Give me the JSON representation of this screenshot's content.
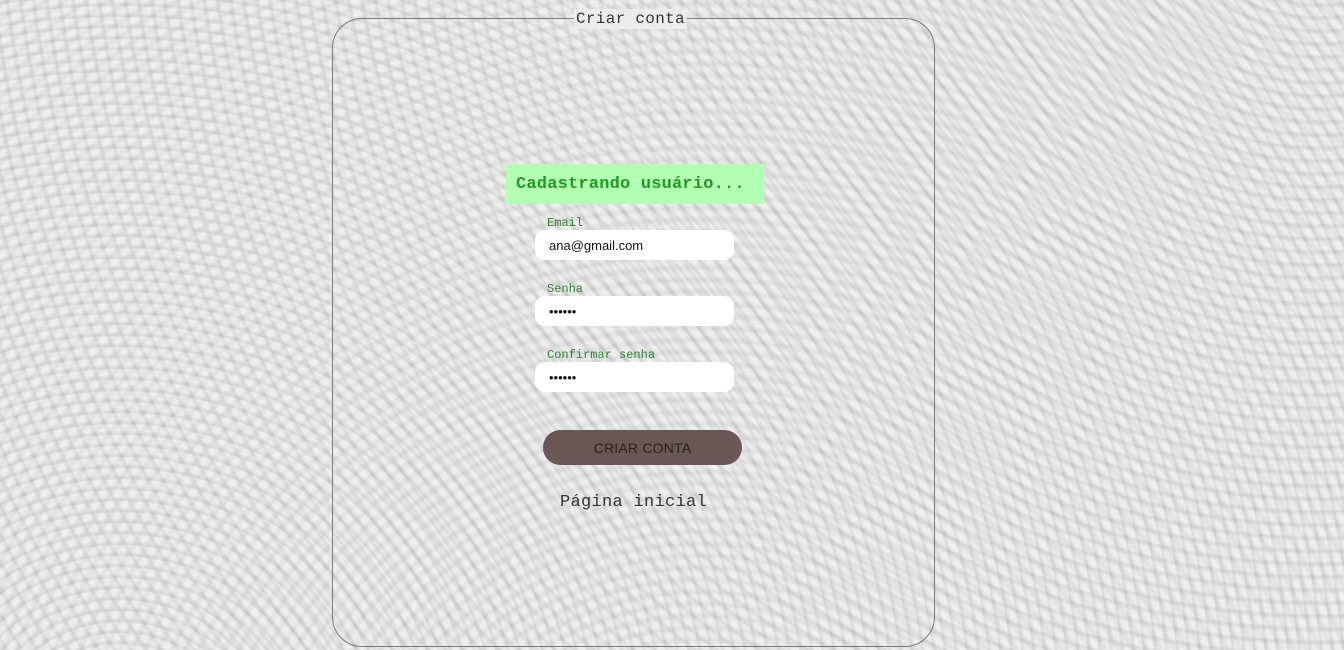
{
  "form": {
    "legend": "Criar conta",
    "status_message": "Cadastrando usuário...",
    "email_label": "Email",
    "email_value": "ana@gmail.com",
    "password_label": "Senha",
    "password_value": "••••••",
    "confirm_label": "Confirmar senha",
    "confirm_value": "••••••",
    "submit_label": "CRIAR CONTA",
    "home_link": "Página inicial"
  },
  "colors": {
    "status_background": "#b3ffb3",
    "status_text": "#1f9a1f",
    "label_text": "#2f7f2f",
    "button_background": "#6b5656"
  }
}
